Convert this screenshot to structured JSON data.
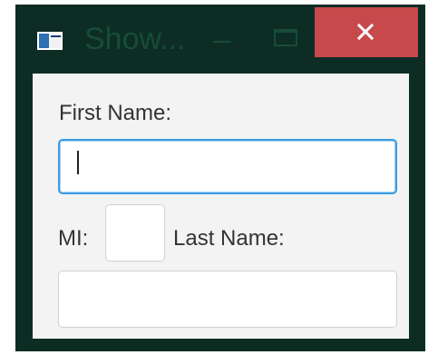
{
  "window": {
    "title": "Show...",
    "app_icon": "javafx-window-icon",
    "controls": {
      "minimize_icon": "minimize-icon",
      "maximize_icon": "maximize-icon",
      "close_icon": "close-icon"
    },
    "colors": {
      "frame": "#0d2d24",
      "close_button": "#c7494b",
      "content_bg": "#f3f3f3",
      "focus_ring": "#3d9be0"
    }
  },
  "form": {
    "first_name_label": "First Name:",
    "first_name_value": "",
    "mi_label": "MI:",
    "mi_value": "",
    "last_name_label": "Last Name:",
    "last_name_value": ""
  }
}
